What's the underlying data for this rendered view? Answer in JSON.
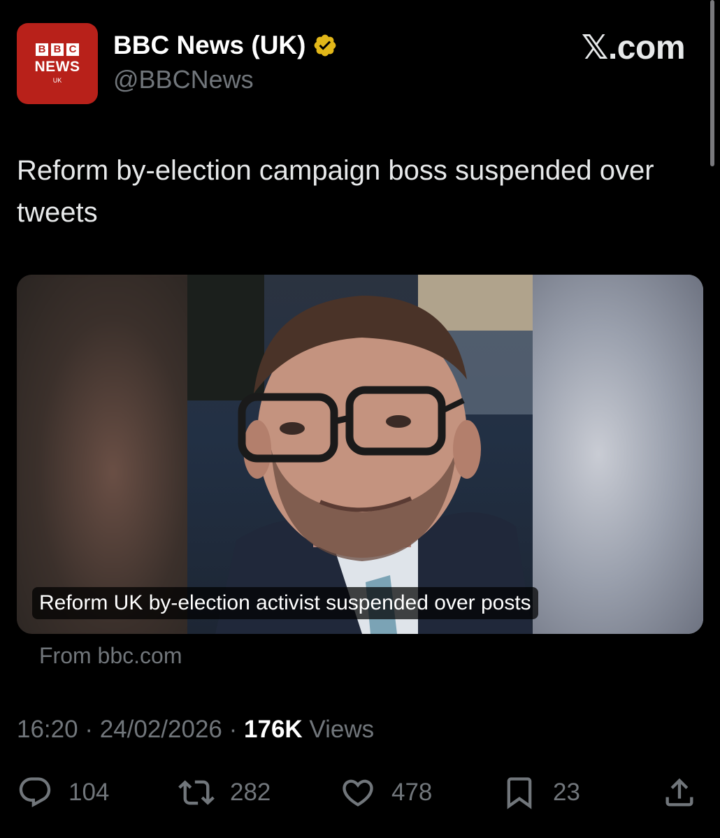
{
  "author": {
    "display_name": "BBC News (UK)",
    "handle": "@BBCNews",
    "avatar": {
      "line1": [
        "B",
        "B",
        "C"
      ],
      "line2": "NEWS",
      "line3": "UK"
    },
    "verified_icon": "verified-badge-gold"
  },
  "brand": "𝕏.com",
  "tweet": {
    "text": "Reform by-election campaign boss suspended over tweets"
  },
  "card": {
    "caption": "Reform UK by-election activist suspended over posts",
    "source": "From bbc.com"
  },
  "meta": {
    "time": "16:20",
    "date": "24/02/2026",
    "views_count": "176K",
    "views_label": "Views",
    "separator": "·"
  },
  "actions": {
    "replies": "104",
    "reposts": "282",
    "likes": "478",
    "bookmarks": "23"
  },
  "colors": {
    "background": "#000000",
    "secondary_text": "#71767b",
    "bbc_red": "#b8211a",
    "verified": "#e2b719"
  }
}
